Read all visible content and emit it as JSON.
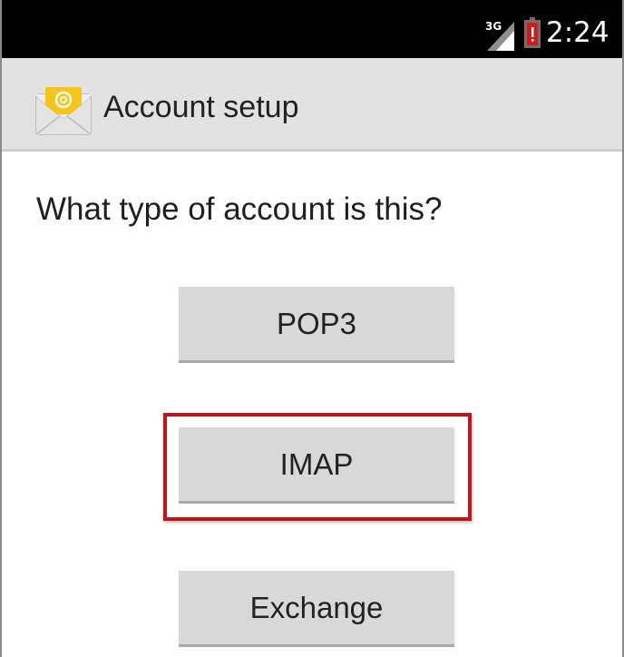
{
  "status_bar": {
    "network_label": "3G",
    "network_icon": "signal-3g-icon",
    "battery_icon": "battery-low-icon",
    "time": "2:24"
  },
  "action_bar": {
    "app_icon": "email-envelope-icon",
    "title": "Account setup"
  },
  "content": {
    "question": "What type of account is this?",
    "options": [
      {
        "label": "POP3"
      },
      {
        "label": "IMAP",
        "highlighted": true
      },
      {
        "label": "Exchange"
      }
    ]
  },
  "colors": {
    "status_bar_bg": "#000000",
    "action_bar_bg": "#e2e2e2",
    "button_bg": "#d8d8d8",
    "highlight": "#c3141b",
    "battery_alert": "#d11a1a"
  }
}
